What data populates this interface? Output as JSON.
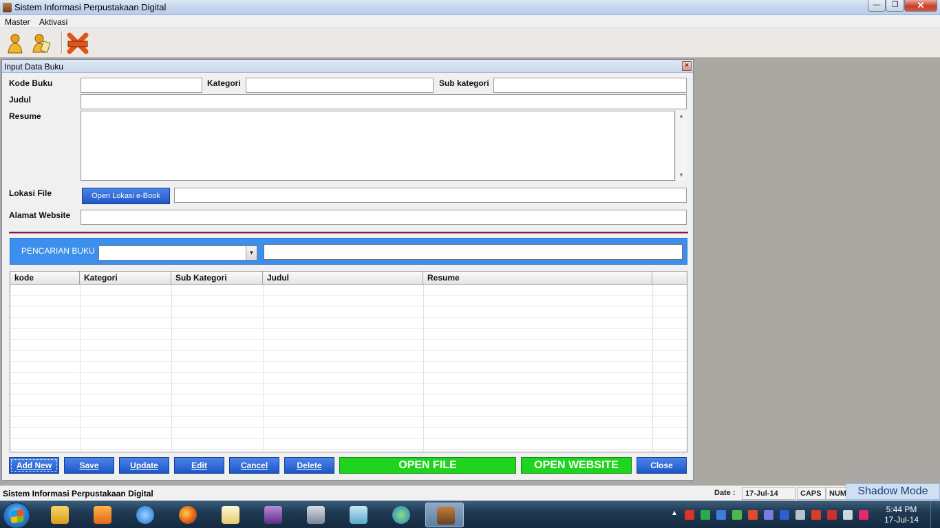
{
  "window": {
    "title": "Sistem Informasi Perpustakaan Digital"
  },
  "menu": {
    "items": [
      "Master",
      "Aktivasi"
    ]
  },
  "toolbar": {
    "icons": [
      "user-icon",
      "user-edit-icon",
      "exit-icon"
    ]
  },
  "child": {
    "title": "Input Data Buku",
    "labels": {
      "kode_buku": "Kode Buku",
      "kategori": "Kategori",
      "sub_kategori": "Sub kategori",
      "judul": "Judul",
      "resume": "Resume",
      "lokasi_file": "Lokasi File",
      "alamat_website": "Alamat Website"
    },
    "values": {
      "kode_buku": "",
      "kategori": "",
      "sub_kategori": "",
      "judul": "",
      "resume": "",
      "lokasi_file": "",
      "alamat_website": ""
    },
    "open_lokasi_button": "Open Lokasi e-Book",
    "search": {
      "label": "PENCARIAN BUKU",
      "selected": "",
      "query": ""
    },
    "grid": {
      "columns": [
        "kode",
        "Kategori",
        "Sub Kategori",
        "Judul",
        "Resume"
      ],
      "rows": []
    },
    "buttons": {
      "add_new": "Add New",
      "save": "Save",
      "update": "Update",
      "edit": "Edit",
      "cancel": "Cancel",
      "delete": "Delete",
      "open_file": "OPEN FILE",
      "open_website": "OPEN WEBSITE",
      "close": "Close"
    }
  },
  "statusbar": {
    "app_name": "Sistem Informasi Perpustakaan Digital",
    "date_label": "Date :",
    "date_value": "17-Jul-14",
    "caps": "CAPS",
    "num": "NUM",
    "shadow_mode": "Shadow Mode"
  },
  "taskbar": {
    "clock_time": "5:44 PM",
    "clock_date": "17-Jul-14"
  },
  "colors": {
    "accent_blue": "#2a63d3",
    "search_bar": "#3c8fec",
    "green_button": "#1fd41f",
    "divider": "#7a1f4a"
  }
}
